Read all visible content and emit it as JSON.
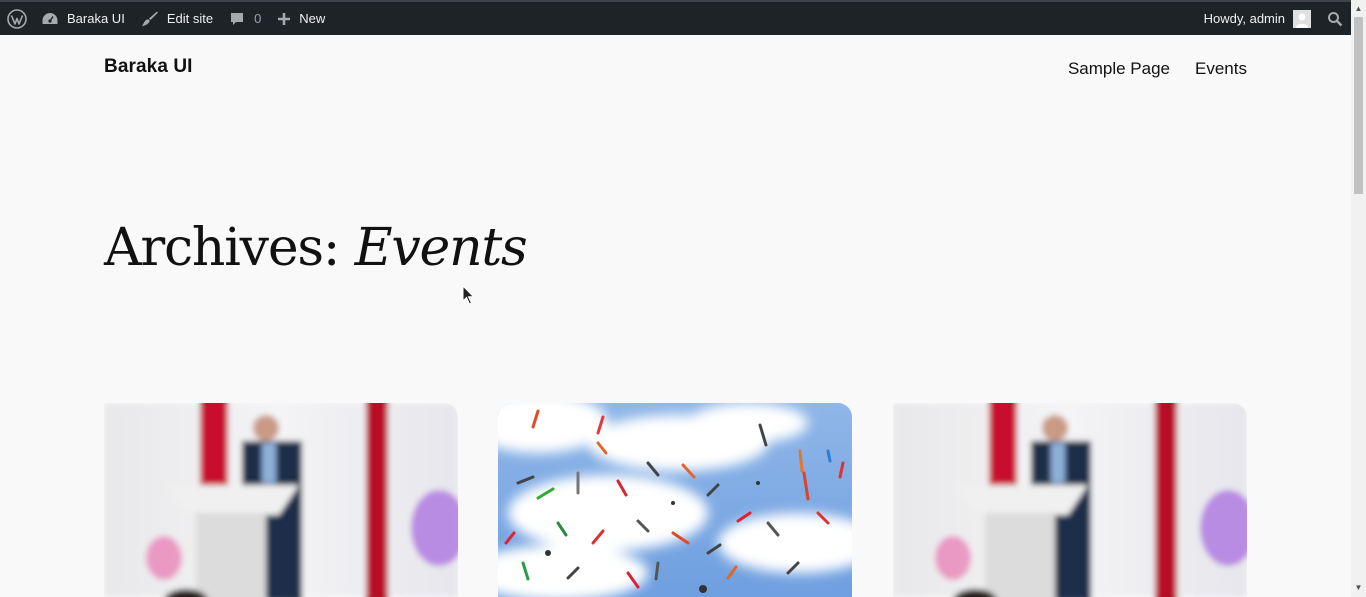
{
  "admin_bar": {
    "site_name": "Baraka UI",
    "edit_site": "Edit site",
    "comments_count": "0",
    "new_label": "New",
    "howdy": "Howdy, admin",
    "icons": [
      "wordpress-logo-icon",
      "dashboard-icon",
      "brush-icon",
      "comment-icon",
      "plus-icon",
      "avatar",
      "search-icon"
    ]
  },
  "header": {
    "site_title": "Baraka UI",
    "nav": [
      "Sample Page",
      "Events"
    ]
  },
  "archive": {
    "prefix": "Archives:",
    "term": "Events"
  },
  "posts": [
    {
      "image": "speaker-at-podium"
    },
    {
      "image": "juggling-clubs-in-sky"
    },
    {
      "image": "speaker-at-podium"
    }
  ],
  "colors": {
    "admin_bar_bg": "#1d2327",
    "page_bg": "#f9f9f9",
    "text": "#111111"
  }
}
